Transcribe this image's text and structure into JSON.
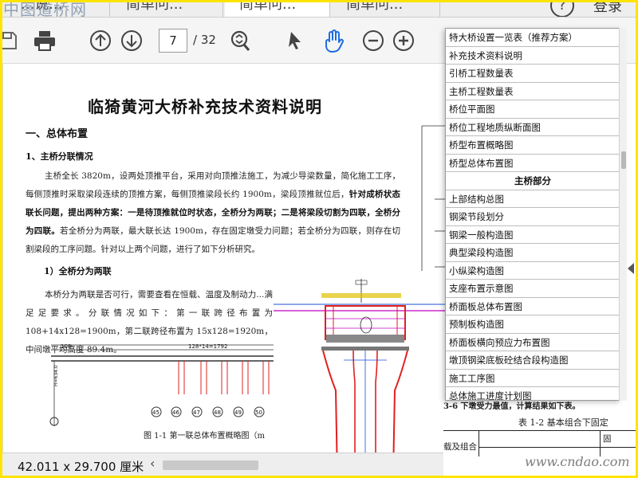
{
  "watermark_top": "中图道桥网",
  "tabs": [
    {
      "label": "...说...",
      "active": false
    },
    {
      "label": "简单问...",
      "active": false
    },
    {
      "label": "简单问...",
      "active": true
    },
    {
      "label": "简单问...",
      "active": false
    }
  ],
  "header": {
    "help_icon": "question-icon",
    "login_label": "登录"
  },
  "toolbar": {
    "icons": [
      "save-icon",
      "print-icon",
      "prev-page-icon",
      "next-page-icon",
      "zoom-fit-icon",
      "select-cursor-icon",
      "hand-tool-icon",
      "zoom-out-icon",
      "zoom-in-icon"
    ],
    "current_page": "7",
    "total_pages": "/ 32"
  },
  "document": {
    "title": "临猗黄河大桥补充技术资料说明",
    "section1": "一、总体布置",
    "section1_1": "1、主桥分联情况",
    "para1_plain": "主桥全长 3820m，设两处顶推平台，采用对向顶推法施工，为减少导梁数量，简化施工工序，每侧顶推时采取梁段连续的顶推方案，每侧顶推梁段长约 1900m，梁段顶推就位后，",
    "para1_bold1": "针对成桥状态联长问题，提出两种方案：一是待顶推就位时状态，全桥分为两联；二是将梁段切割为四联，全桥分为四联。",
    "para1_tail": "若全桥分为两联，最大联长达 1900m，存在固定墩受力问题；若全桥分为四联，则存在切割梁段的工序问题。针对以上两个问题，进行了如下分析研究。",
    "subsection": "1）全桥分为两联",
    "para2": "本桥分为两联是否可行，需要查看在恒载、温度及制动力...满足足要求。分联情况如下：第一联跨径布置为 108+14x128=1900m，第二联跨径布置为 15x128=1920m，中间墩平均高度 89.4m。",
    "fig_caption": "图 1-1  第一联总体布置概略图（m",
    "elev_labels": {
      "span1": "108",
      "span2": "128*14=1792",
      "piers": [
        "45",
        "46",
        "47",
        "48",
        "49",
        "50"
      ],
      "side_elev": "H=634.0"
    }
  },
  "side_list": {
    "items": [
      {
        "label": "特大桥设置一览表（推荐方案）",
        "head": false
      },
      {
        "label": "补充技术资料说明",
        "head": false
      },
      {
        "label": "引桥工程数量表",
        "head": false
      },
      {
        "label": "主桥工程数量表",
        "head": false
      },
      {
        "label": "桥位平面图",
        "head": false
      },
      {
        "label": "桥位工程地质纵断面图",
        "head": false
      },
      {
        "label": "桥型布置概略图",
        "head": false
      },
      {
        "label": "桥型总体布置图",
        "head": false
      },
      {
        "label": "主桥部分",
        "head": true
      },
      {
        "label": "上部结构总图",
        "head": false
      },
      {
        "label": "钢梁节段划分",
        "head": false
      },
      {
        "label": "钢梁一般构造图",
        "head": false
      },
      {
        "label": "典型梁段构造图",
        "head": false
      },
      {
        "label": "小纵梁构造图",
        "head": false
      },
      {
        "label": "支座布置示意图",
        "head": false
      },
      {
        "label": "桥面板总体布置图",
        "head": false
      },
      {
        "label": "预制板构造图",
        "head": false
      },
      {
        "label": "桥面板横向预应力布置图",
        "head": false
      },
      {
        "label": "墩顶钢梁底板砼结合段构造图",
        "head": false
      },
      {
        "label": "施工工序图",
        "head": false
      },
      {
        "label": "总体施工进度计划图",
        "head": false
      }
    ]
  },
  "bottom_right": {
    "line1": "3-6 下墩受力最值，计算结果如下表。",
    "table_title": "表 1-2  基本组合下固定",
    "col_label": "载及组合",
    "col_right": "固"
  },
  "watermark_bottom": "www.cndao.com",
  "status": {
    "dimensions": "42.011 x 29.700 厘米"
  },
  "colors": {
    "frame": "#ffe400",
    "accent_red": "#e02020",
    "accent_blue": "#1c4fd6",
    "drawing_magenta": "#c000c0"
  }
}
